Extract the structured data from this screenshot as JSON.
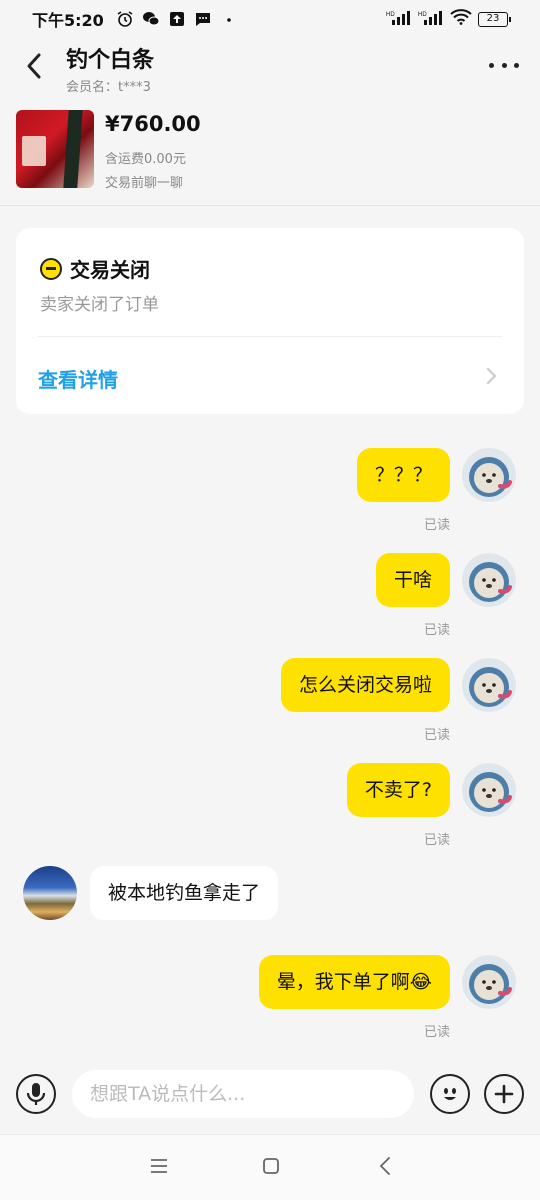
{
  "status_bar": {
    "time": "下午5:20",
    "battery": "23"
  },
  "header": {
    "title": "钓个白条",
    "member_label": "会员名：t***3"
  },
  "product": {
    "price": "¥760.00",
    "shipping": "含运费0.00元",
    "chat_hint": "交易前聊一聊"
  },
  "trade_card": {
    "status": "交易关闭",
    "description": "卖家关闭了订单",
    "detail_link": "查看详情"
  },
  "messages": [
    {
      "from": "me",
      "text": "？？？",
      "read": "已读"
    },
    {
      "from": "me",
      "text": "干啥",
      "read": "已读"
    },
    {
      "from": "me",
      "text": "怎么关闭交易啦",
      "read": "已读"
    },
    {
      "from": "me",
      "text": "不卖了?",
      "read": "已读"
    },
    {
      "from": "them",
      "text": "被本地钓鱼拿走了"
    },
    {
      "from": "me",
      "text": "晕，我下单了啊😂",
      "read": "已读"
    }
  ],
  "input": {
    "placeholder": "想跟TA说点什么..."
  },
  "colors": {
    "accent_yellow": "#ffe100",
    "link_blue": "#21a0e8"
  }
}
